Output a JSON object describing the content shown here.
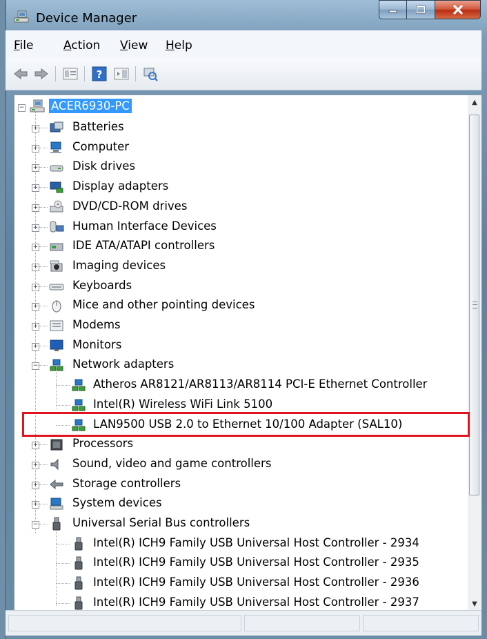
{
  "window": {
    "title": "Device Manager"
  },
  "menu": [
    {
      "label": "File",
      "mnemonic": "F",
      "rest": "ile"
    },
    {
      "label": "Action",
      "mnemonic": "A",
      "rest": "ction"
    },
    {
      "label": "View",
      "mnemonic": "V",
      "rest": "iew"
    },
    {
      "label": "Help",
      "mnemonic": "H",
      "rest": "elp"
    }
  ],
  "toolbar": [
    "back-icon",
    "forward-icon",
    "properties-view-icon",
    "help-icon",
    "action-pane-icon",
    "scan-hardware-icon"
  ],
  "tree": {
    "root": "ACER6930-PC",
    "categories": [
      {
        "label": "Batteries",
        "icon": "battery-icon",
        "expanded": false
      },
      {
        "label": "Computer",
        "icon": "computer-icon",
        "expanded": false
      },
      {
        "label": "Disk drives",
        "icon": "disk-icon",
        "expanded": false
      },
      {
        "label": "Display adapters",
        "icon": "display-adapter-icon",
        "expanded": false
      },
      {
        "label": "DVD/CD-ROM drives",
        "icon": "dvd-icon",
        "expanded": false
      },
      {
        "label": "Human Interface Devices",
        "icon": "hid-icon",
        "expanded": false
      },
      {
        "label": "IDE ATA/ATAPI controllers",
        "icon": "ide-icon",
        "expanded": false
      },
      {
        "label": "Imaging devices",
        "icon": "camera-icon",
        "expanded": false
      },
      {
        "label": "Keyboards",
        "icon": "keyboard-icon",
        "expanded": false
      },
      {
        "label": "Mice and other pointing devices",
        "icon": "mouse-icon",
        "expanded": false
      },
      {
        "label": "Modems",
        "icon": "modem-icon",
        "expanded": false
      },
      {
        "label": "Monitors",
        "icon": "monitor-icon",
        "expanded": false
      },
      {
        "label": "Network adapters",
        "icon": "network-icon",
        "expanded": true,
        "children": [
          "Atheros AR8121/AR8113/AR8114 PCI-E Ethernet Controller",
          "Intel(R) Wireless WiFi Link 5100",
          "LAN9500 USB 2.0 to Ethernet 10/100 Adapter (SAL10)"
        ]
      },
      {
        "label": "Processors",
        "icon": "processor-icon",
        "expanded": false
      },
      {
        "label": "Sound, video and game controllers",
        "icon": "speaker-icon",
        "expanded": false
      },
      {
        "label": "Storage controllers",
        "icon": "storage-icon",
        "expanded": false
      },
      {
        "label": "System devices",
        "icon": "system-icon",
        "expanded": false
      },
      {
        "label": "Universal Serial Bus controllers",
        "icon": "usb-icon",
        "expanded": true,
        "children": [
          "Intel(R) ICH9 Family USB Universal Host Controller - 2934",
          "Intel(R) ICH9 Family USB Universal Host Controller - 2935",
          "Intel(R) ICH9 Family USB Universal Host Controller - 2936",
          "Intel(R) ICH9 Family USB Universal Host Controller - 2937"
        ]
      }
    ]
  },
  "colors": {
    "selection": "#3399ff",
    "highlight_box": "#e0141e",
    "menubar": "#f3f6fa"
  }
}
